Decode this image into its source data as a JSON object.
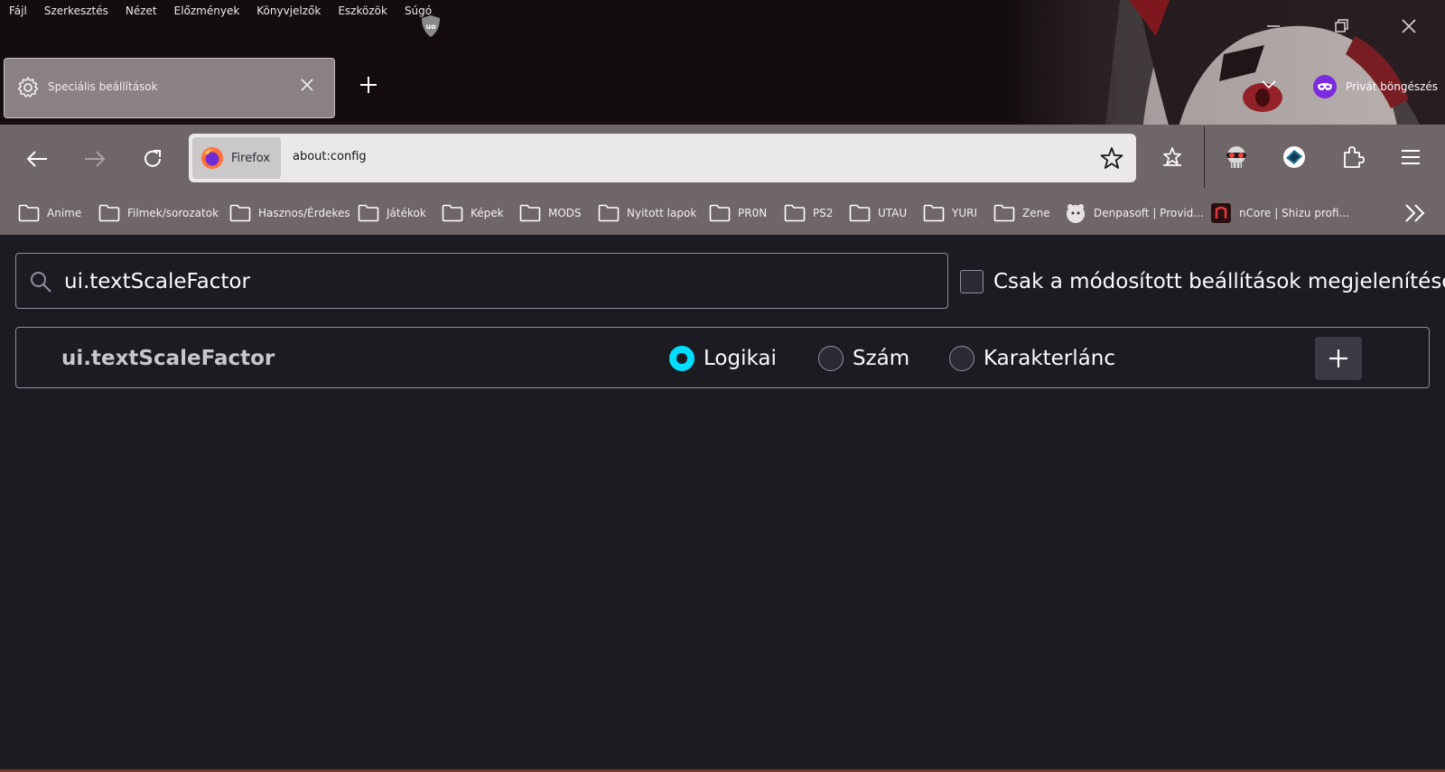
{
  "menu": [
    "Fájl",
    "Szerkesztés",
    "Nézet",
    "Előzmények",
    "Könyvjelzők",
    "Eszközök",
    "Súgó"
  ],
  "tab": {
    "title": "Speciális beállítások"
  },
  "private_label": "Privát böngészés",
  "urlbar": {
    "identity": "Firefox",
    "url": "about:config"
  },
  "bookmarks": [
    {
      "label": "Anime",
      "icon": "folder-icon"
    },
    {
      "label": "Filmek/sorozatok",
      "icon": "folder-icon"
    },
    {
      "label": "Hasznos/Érdekes",
      "icon": "folder-icon"
    },
    {
      "label": "Játékok",
      "icon": "folder-icon"
    },
    {
      "label": "Képek",
      "icon": "folder-icon"
    },
    {
      "label": "MODS",
      "icon": "folder-icon"
    },
    {
      "label": "Nyitott lapok",
      "icon": "folder-icon"
    },
    {
      "label": "PR0N",
      "icon": "folder-icon"
    },
    {
      "label": "PS2",
      "icon": "folder-icon"
    },
    {
      "label": "UTAU",
      "icon": "folder-icon"
    },
    {
      "label": "YURI",
      "icon": "folder-icon"
    },
    {
      "label": "Zene",
      "icon": "folder-icon"
    },
    {
      "label": "Denpasoft | Provid...",
      "icon": "site-favicon"
    },
    {
      "label": "nCore | Shizu profi...",
      "icon": "site-favicon"
    }
  ],
  "search": {
    "value": "ui.textScaleFactor"
  },
  "modified_only_label": "Csak a módosított beállítások megjelenítése",
  "pref": {
    "name": "ui.textScaleFactor",
    "types": [
      "Logikai",
      "Szám",
      "Karakterlánc"
    ],
    "selected_type": "Logikai"
  },
  "colors": {
    "accent": "#00ddff",
    "background": "#1c1b22",
    "private": "#7a2be0"
  }
}
